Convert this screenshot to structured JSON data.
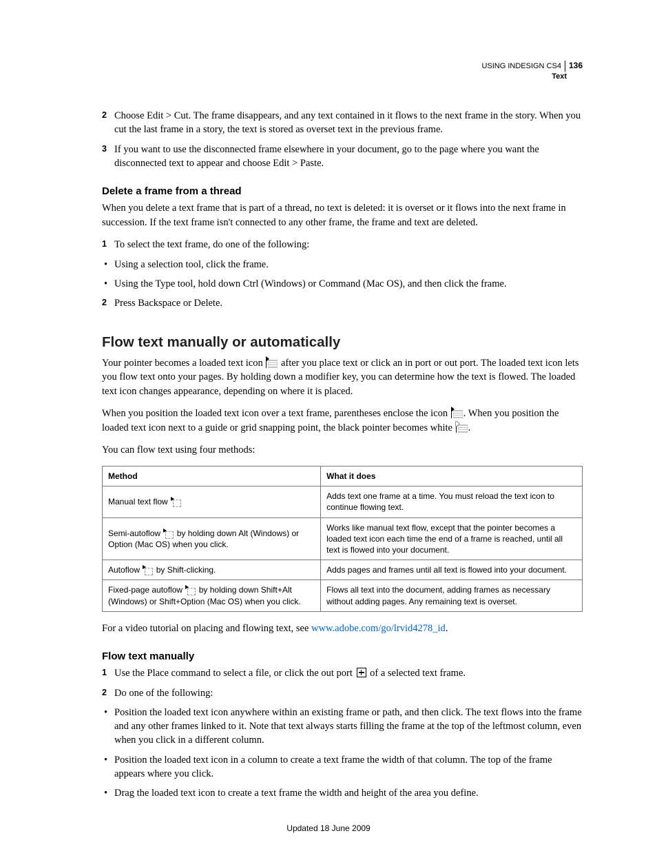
{
  "header": {
    "product": "USING INDESIGN CS4",
    "page_number": "136",
    "section": "Text"
  },
  "intro_steps": {
    "step2": "Choose Edit > Cut. The frame disappears, and any text contained in it flows to the next frame in the story. When you cut the last frame in a story, the text is stored as overset text in the previous frame.",
    "step3": "If you want to use the disconnected frame elsewhere in your document, go to the page where you want the disconnected text to appear and choose Edit > Paste."
  },
  "delete_section": {
    "heading": "Delete a frame from a thread",
    "intro": "When you delete a text frame that is part of a thread, no text is deleted: it is overset or it flows into the next frame in succession. If the text frame isn't connected to any other frame, the frame and text are deleted.",
    "step1": "To select the text frame, do one of the following:",
    "bullet1": "Using a selection tool, click the frame.",
    "bullet2": "Using the Type tool, hold down Ctrl (Windows) or Command (Mac OS), and then click the frame.",
    "step2": "Press Backspace or Delete."
  },
  "flow_section": {
    "heading": "Flow text manually or automatically",
    "p1a": "Your pointer becomes a loaded text icon ",
    "p1b": " after you place text or click an in port or out port. The loaded text icon lets you flow text onto your pages. By holding down a modifier key, you can determine how the text is flowed. The loaded text icon changes appearance, depending on where it is placed.",
    "p2a": "When you position the loaded text icon over a text frame, parentheses enclose the icon ",
    "p2b": ". When you position the loaded text icon next to a guide or grid snapping point, the black pointer becomes white ",
    "p2c": ".",
    "p3": "You can flow text using four methods:",
    "table": {
      "h1": "Method",
      "h2": "What it does",
      "rows": [
        {
          "method_a": "Manual text flow ",
          "method_b": "",
          "does": "Adds text one frame at a time. You must reload the text icon to continue flowing text."
        },
        {
          "method_a": "Semi-autoflow ",
          "method_b": " by holding down Alt (Windows) or Option (Mac OS) when you click.",
          "does": "Works like manual text flow, except that the pointer becomes a loaded text icon each time the end of a frame is reached, until all text is flowed into your document."
        },
        {
          "method_a": "Autoflow ",
          "method_b": " by Shift-clicking.",
          "does": "Adds pages and frames until all text is flowed into your document."
        },
        {
          "method_a": "Fixed-page autoflow ",
          "method_b": " by holding down Shift+Alt (Windows) or Shift+Option (Mac OS) when you click.",
          "does": "Flows all text into the document, adding frames as necessary without adding pages. Any remaining text is overset."
        }
      ]
    },
    "video_a": "For a video tutorial on placing and flowing text, see ",
    "video_link": "www.adobe.com/go/lrvid4278_id",
    "video_b": "."
  },
  "manual_section": {
    "heading": "Flow text manually",
    "step1a": "Use the Place command to select a file, or click the out port ",
    "step1b": " of a selected text frame.",
    "step2": "Do one of the following:",
    "bullet1": "Position the loaded text icon anywhere within an existing frame or path, and then click. The text flows into the frame and any other frames linked to it. Note that text always starts filling the frame at the top of the leftmost column, even when you click in a different column.",
    "bullet2": "Position the loaded text icon in a column to create a text frame the width of that column. The top of the frame appears where you click.",
    "bullet3": "Drag the loaded text icon to create a text frame the width and height of the area you define."
  },
  "footer": "Updated 18 June 2009"
}
